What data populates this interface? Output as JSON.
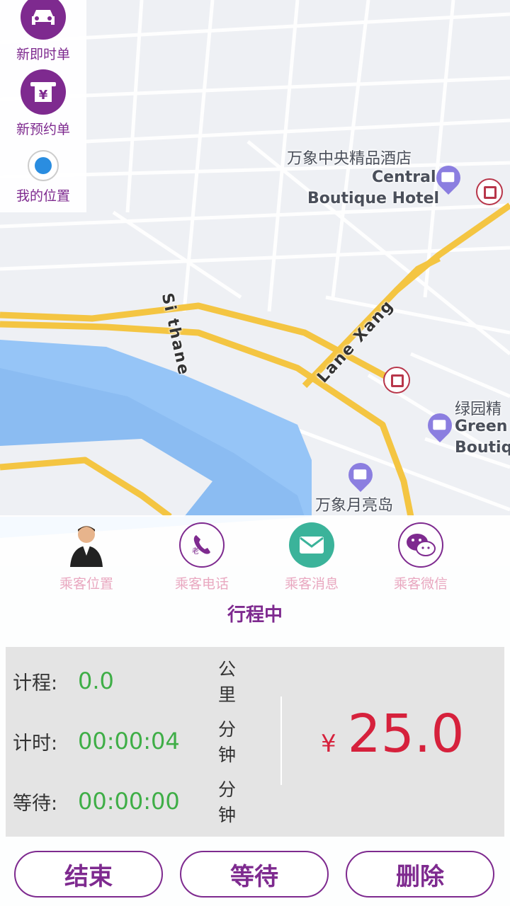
{
  "sidebar": {
    "items": [
      {
        "label": "新即时单",
        "icon": "car-icon"
      },
      {
        "label": "新预约单",
        "icon": "yen-ticket-icon"
      },
      {
        "label": "我的位置",
        "icon": "location-dot-icon"
      }
    ]
  },
  "map": {
    "pois": [
      {
        "zh": "万象中央精品酒店",
        "en1": "Central",
        "en2": "Boutique Hotel"
      },
      {
        "zh": "绿园精",
        "en1": "Green",
        "en2": "Boutiq"
      },
      {
        "zh": "万象月亮岛",
        "en1": "",
        "en2": ""
      }
    ],
    "roads": [
      "Si thane",
      "Lane Xang"
    ]
  },
  "actions": [
    {
      "label": "乘客位置",
      "icon": "passenger-avatar-icon"
    },
    {
      "label": "乘客电话",
      "icon": "phone-icon"
    },
    {
      "label": "乘客消息",
      "icon": "message-icon"
    },
    {
      "label": "乘客微信",
      "icon": "wechat-icon"
    }
  ],
  "status": "行程中",
  "meter": {
    "distance": {
      "label": "计程:",
      "value": "0.0",
      "unit": "公里"
    },
    "time": {
      "label": "计时:",
      "value": "00:00:04",
      "unit": "分钟"
    },
    "wait": {
      "label": "等待:",
      "value": "00:00:00",
      "unit": "分钟"
    },
    "currency": "¥",
    "fare": "25.0"
  },
  "buttons": {
    "end": "结束",
    "wait": "等待",
    "delete": "删除"
  },
  "colors": {
    "accent": "#7e2a8f",
    "green": "#3fae47",
    "fare": "#d6213c"
  }
}
